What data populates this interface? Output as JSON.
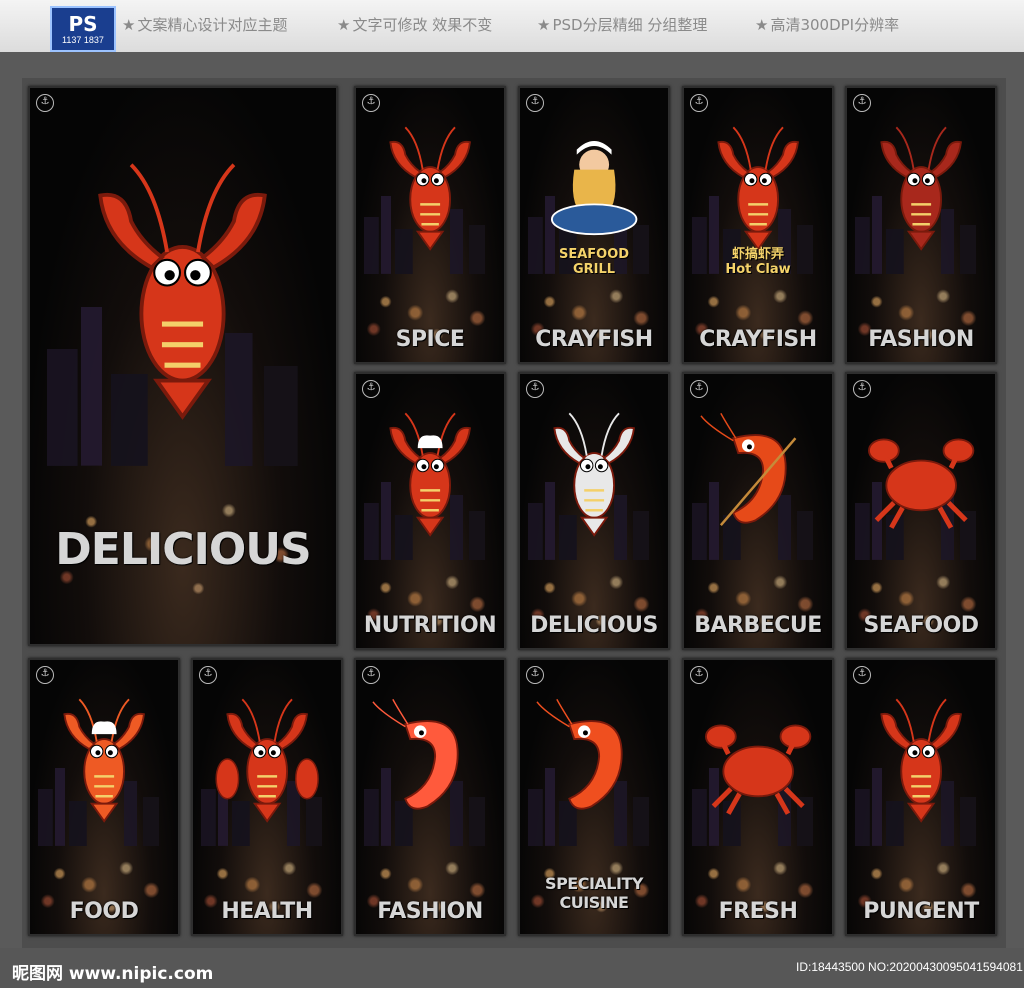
{
  "header": {
    "ps_badge": "PS",
    "ps_number": "1137 1837",
    "features": [
      "文案精心设计对应主题",
      "文字可修改 效果不变",
      "PSD分层精细 分组整理",
      "高清300DPI分辨率"
    ]
  },
  "posters": [
    {
      "label": "DELICIOUS",
      "icon": "lobster-icon",
      "color": "#d6361a"
    },
    {
      "label": "SPICE",
      "icon": "crayfish-icon",
      "color": "#d6361a"
    },
    {
      "label": "CRAYFISH",
      "icon": "chef-girl-icon",
      "color": "#e9b54a",
      "badge_lines": [
        "SEAFOOD",
        "GRILL"
      ]
    },
    {
      "label": "CRAYFISH",
      "icon": "crayfish-icon",
      "color": "#d6361a",
      "badge_lines": [
        "虾搞虾弄",
        "Hot Claw"
      ]
    },
    {
      "label": "FASHION",
      "icon": "lobster-icon",
      "color": "#a8281c"
    },
    {
      "label": "NUTRITION",
      "icon": "shrimp-chef-icon",
      "color": "#d6361a"
    },
    {
      "label": "DELICIOUS",
      "icon": "crayfish-icon",
      "color": "#e8e8e8"
    },
    {
      "label": "BARBECUE",
      "icon": "shrimp-skewer-icon",
      "color": "#e64a19"
    },
    {
      "label": "SEAFOOD",
      "icon": "crab-icon",
      "color": "#d6361a"
    },
    {
      "label": "FOOD",
      "icon": "shrimp-chef-icon",
      "color": "#ee5a24"
    },
    {
      "label": "HEALTH",
      "icon": "crayfish-group-icon",
      "color": "#d6361a"
    },
    {
      "label": "FASHION",
      "icon": "shrimp-icon",
      "color": "#ff5a3c"
    },
    {
      "label": "SPECIALITY CUISINE",
      "icon": "shrimp-icon",
      "color": "#ef4f1f"
    },
    {
      "label": "FRESH",
      "icon": "crab-icon",
      "color": "#d6361a"
    },
    {
      "label": "PUNGENT",
      "icon": "crayfish-icon",
      "color": "#d6361a"
    }
  ],
  "footer": {
    "site": "昵图网 www.nipic.com",
    "id_text": "ID:18443500 NO:20200430095041594081"
  }
}
